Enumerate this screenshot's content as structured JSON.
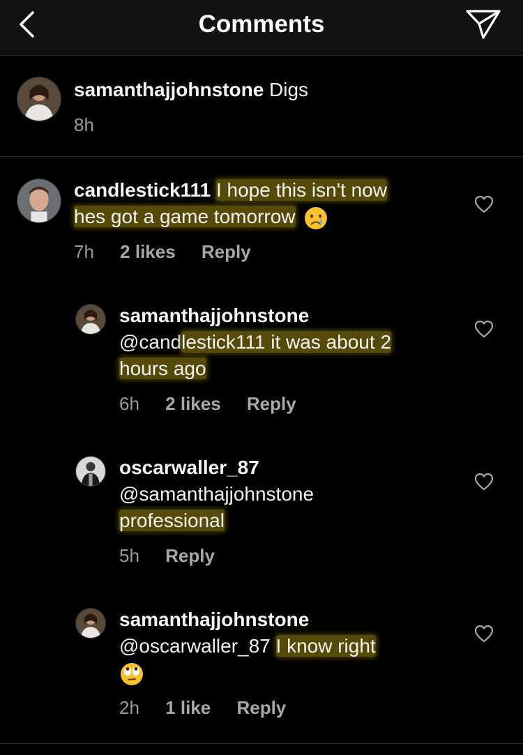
{
  "header": {
    "title": "Comments",
    "back_icon": "chevron-left-icon",
    "send_icon": "paper-plane-icon"
  },
  "caption": {
    "username": "samanthajjohnstone",
    "text": "Digs",
    "time": "8h"
  },
  "comments": [
    {
      "username": "candlestick111",
      "text_highlighted_1": "I hope this isn't now",
      "text_highlighted_2": "hes got a game tomorrow",
      "emoji": "crying-face-emoji",
      "time": "7h",
      "likes": "2 likes",
      "reply": "Reply"
    },
    {
      "username": "samanthajjohnstone",
      "mention": "@cand",
      "text_highlighted_1": "lestick111 it was about 2",
      "text_highlighted_2": "hours ago",
      "time": "6h",
      "likes": "2 likes",
      "reply": "Reply"
    },
    {
      "username": "oscarwaller_87",
      "mention": "@samanthajjohnstone",
      "text_highlighted_1": "professional",
      "time": "5h",
      "reply": "Reply"
    },
    {
      "username": "samanthajjohnstone",
      "mention": "@oscarwaller_87",
      "text_highlighted_1": "I know right",
      "emoji": "face-with-rolling-eyes-emoji",
      "time": "2h",
      "likes": "1 like",
      "reply": "Reply"
    }
  ],
  "colors": {
    "background": "#000000",
    "header_bg": "#121212",
    "highlight": "#9b870c",
    "meta_text": "#9a9a9a"
  }
}
